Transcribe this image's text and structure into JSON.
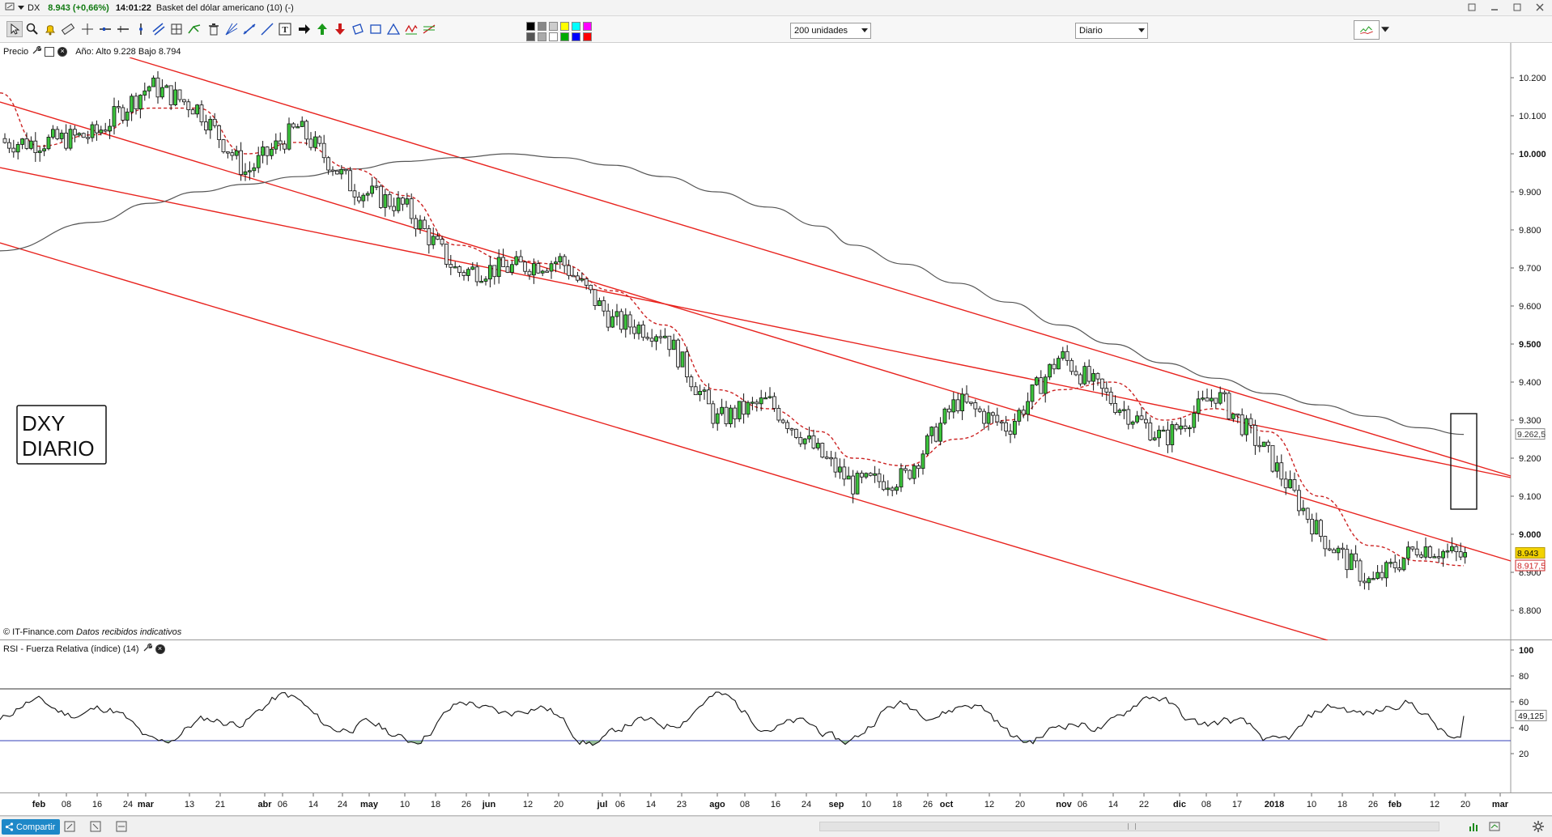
{
  "header": {
    "symbol": "DX",
    "last_price_change": "8.943 (+0,66%)",
    "time": "14:01:22",
    "description": "Basket del dólar americano (10) (-)"
  },
  "toolbar": {
    "units_select": "200 unidades",
    "period_select": "Diario",
    "icons": [
      "cursor-icon",
      "zoom-icon",
      "alert-icon",
      "ruler-icon",
      "crosshair-icon",
      "line-tool-icon",
      "grid-icon",
      "trend-tool-icon",
      "fan-icon",
      "trash-icon",
      "text-icon",
      "arrow-right-icon",
      "arrow-up-icon",
      "arrow-down-icon",
      "shape-icon",
      "rectangle-icon",
      "triangle-icon",
      "wave-icon",
      "fibonacci-icon"
    ],
    "colors": [
      "#000000",
      "#555555",
      "#888888",
      "#aaaaaa",
      "#cccccc",
      "#ffffff",
      "#ffff00",
      "#00aa00",
      "#00ffff",
      "#0000ff",
      "#ff00ff",
      "#ff0000"
    ]
  },
  "price_panel": {
    "legend": "Precio",
    "year_info": "Año: Alto 9.228 Bajo 8.794",
    "source": "© IT-Finance.com",
    "source_note": "Datos recibidos indicativos",
    "label_box_line1": "DXY",
    "label_box_line2": "DIARIO",
    "current_price_tag": "8.943",
    "ma_tag_dashed": "8.917,5",
    "ma_tag_long": "9.262,5"
  },
  "rsi_panel": {
    "legend": "RSI - Fuerza Relativa (índice) (14)",
    "current_value_tag": "49,125"
  },
  "footer": {
    "share_label": "Compartir"
  },
  "chart_data": [
    {
      "type": "candlestick",
      "title": "",
      "ylim": [
        8.75,
        10.25
      ],
      "y_ticks": [
        "10.200",
        "10.100",
        "10.000",
        "9.900",
        "9.800",
        "9.700",
        "9.600",
        "9.500",
        "9.400",
        "9.300",
        "9.200",
        "9.100",
        "9.000",
        "8.900",
        "8.800"
      ],
      "x_ticks": [
        "feb",
        "08",
        "16",
        "24",
        "mar",
        "13",
        "21",
        "abr",
        "06",
        "14",
        "24",
        "may",
        "10",
        "18",
        "26",
        "jun",
        "12",
        "20",
        "jul",
        "06",
        "14",
        "23",
        "ago",
        "08",
        "16",
        "24",
        "sep",
        "10",
        "18",
        "26",
        "oct",
        "12",
        "20",
        "nov",
        "06",
        "14",
        "22",
        "dic",
        "08",
        "17",
        "2018",
        "10",
        "18",
        "26",
        "feb",
        "12",
        "20",
        "mar"
      ],
      "series": [
        {
          "name": "",
          "kind": "close_approx",
          "x": [
            "2017-01-31",
            "2017-02-15",
            "2017-03-02",
            "2017-03-15",
            "2017-03-28",
            "2017-04-11",
            "2017-04-26",
            "2017-05-10",
            "2017-05-24",
            "2017-06-07",
            "2017-06-21",
            "2017-07-05",
            "2017-07-19",
            "2017-08-02",
            "2017-08-16",
            "2017-08-30",
            "2017-09-08",
            "2017-09-22",
            "2017-10-06",
            "2017-10-20",
            "2017-11-03",
            "2017-11-17",
            "2017-12-01",
            "2017-12-15",
            "2017-12-29",
            "2018-01-12",
            "2018-01-26",
            "2018-02-08",
            "2018-02-20"
          ],
          "values": [
            10.03,
            10.05,
            10.18,
            10.12,
            9.95,
            10.07,
            9.91,
            9.86,
            9.69,
            9.7,
            9.72,
            9.56,
            9.53,
            9.3,
            9.35,
            9.21,
            9.13,
            9.15,
            9.35,
            9.28,
            9.47,
            9.35,
            9.25,
            9.37,
            9.21,
            9.0,
            8.87,
            8.97,
            8.94
          ]
        },
        {
          "name": "",
          "kind": "dashed_moving_average",
          "values": [
            10.02,
            10.05,
            10.12,
            10.12,
            10.0,
            10.03,
            9.96,
            9.89,
            9.76,
            9.72,
            9.71,
            9.64,
            9.55,
            9.38,
            9.33,
            9.27,
            9.2,
            9.18,
            9.25,
            9.3,
            9.38,
            9.4,
            9.3,
            9.33,
            9.27,
            9.1,
            8.97,
            8.93,
            8.9175
          ]
        },
        {
          "name": "",
          "kind": "long_moving_average",
          "values": [
            9.77,
            9.82,
            9.87,
            9.9,
            9.92,
            9.94,
            9.96,
            9.98,
            9.99,
            10.0,
            9.99,
            9.97,
            9.94,
            9.9,
            9.86,
            9.81,
            9.76,
            9.71,
            9.66,
            9.61,
            9.55,
            9.5,
            9.45,
            9.41,
            9.37,
            9.34,
            9.31,
            9.28,
            9.2625
          ]
        }
      ],
      "annotations": [
        "DXY",
        "DIARIO"
      ]
    },
    {
      "type": "line",
      "title": "RSI - Fuerza Relativa (índice) (14)",
      "ylim": [
        0,
        100
      ],
      "y_ticks": [
        "100",
        "80",
        "60",
        "40",
        "20"
      ],
      "overbought": 70,
      "oversold": 30,
      "current": 49.125
    }
  ]
}
